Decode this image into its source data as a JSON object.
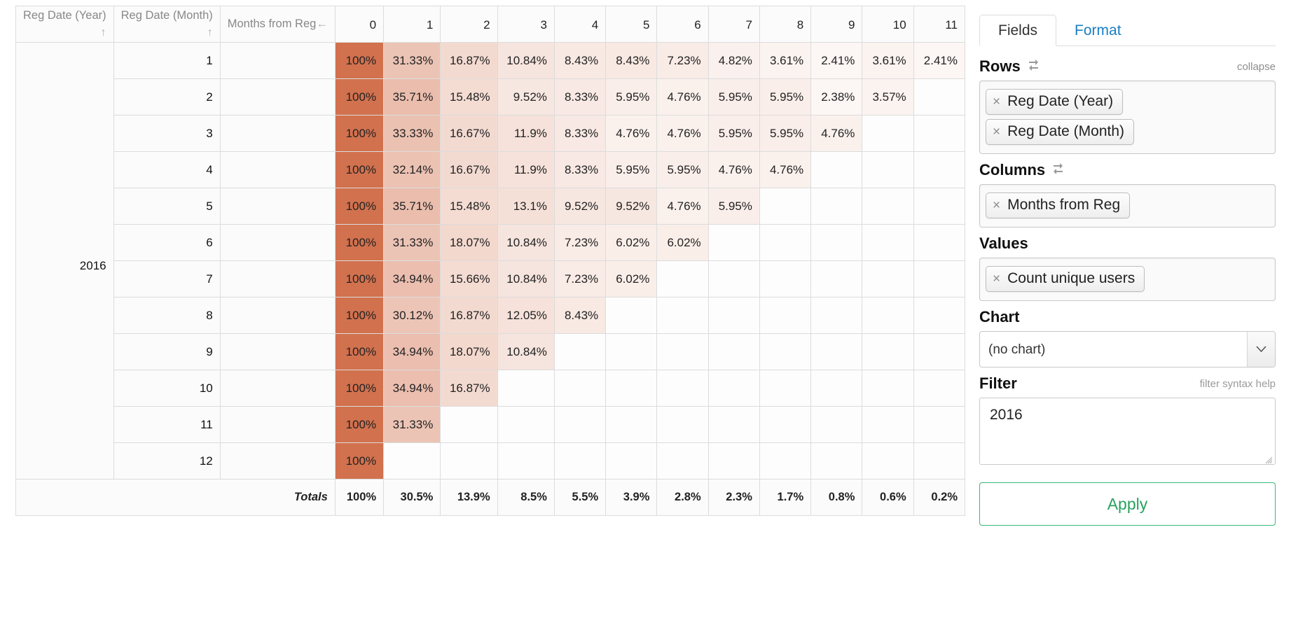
{
  "table": {
    "row_headers": [
      {
        "label": "Reg Date (Year)",
        "sort": "↑"
      },
      {
        "label": "Reg Date (Month)",
        "sort": "↑"
      },
      {
        "label": "Months from Reg",
        "sort": "←"
      }
    ],
    "column_headers": [
      "0",
      "1",
      "2",
      "3",
      "4",
      "5",
      "6",
      "7",
      "8",
      "9",
      "10",
      "11"
    ],
    "year": "2016",
    "rows": [
      {
        "month": "1",
        "values": [
          "100%",
          "31.33%",
          "16.87%",
          "10.84%",
          "8.43%",
          "8.43%",
          "7.23%",
          "4.82%",
          "3.61%",
          "2.41%",
          "3.61%",
          "2.41%"
        ]
      },
      {
        "month": "2",
        "values": [
          "100%",
          "35.71%",
          "15.48%",
          "9.52%",
          "8.33%",
          "5.95%",
          "4.76%",
          "5.95%",
          "5.95%",
          "2.38%",
          "3.57%",
          ""
        ]
      },
      {
        "month": "3",
        "values": [
          "100%",
          "33.33%",
          "16.67%",
          "11.9%",
          "8.33%",
          "4.76%",
          "4.76%",
          "5.95%",
          "5.95%",
          "4.76%",
          "",
          ""
        ]
      },
      {
        "month": "4",
        "values": [
          "100%",
          "32.14%",
          "16.67%",
          "11.9%",
          "8.33%",
          "5.95%",
          "5.95%",
          "4.76%",
          "4.76%",
          "",
          "",
          ""
        ]
      },
      {
        "month": "5",
        "values": [
          "100%",
          "35.71%",
          "15.48%",
          "13.1%",
          "9.52%",
          "9.52%",
          "4.76%",
          "5.95%",
          "",
          "",
          "",
          ""
        ]
      },
      {
        "month": "6",
        "values": [
          "100%",
          "31.33%",
          "18.07%",
          "10.84%",
          "7.23%",
          "6.02%",
          "6.02%",
          "",
          "",
          "",
          "",
          ""
        ]
      },
      {
        "month": "7",
        "values": [
          "100%",
          "34.94%",
          "15.66%",
          "10.84%",
          "7.23%",
          "6.02%",
          "",
          "",
          "",
          "",
          "",
          ""
        ]
      },
      {
        "month": "8",
        "values": [
          "100%",
          "30.12%",
          "16.87%",
          "12.05%",
          "8.43%",
          "",
          "",
          "",
          "",
          "",
          "",
          ""
        ]
      },
      {
        "month": "9",
        "values": [
          "100%",
          "34.94%",
          "18.07%",
          "10.84%",
          "",
          "",
          "",
          "",
          "",
          "",
          "",
          ""
        ]
      },
      {
        "month": "10",
        "values": [
          "100%",
          "34.94%",
          "16.87%",
          "",
          "",
          "",
          "",
          "",
          "",
          "",
          "",
          ""
        ]
      },
      {
        "month": "11",
        "values": [
          "100%",
          "31.33%",
          "",
          "",
          "",
          "",
          "",
          "",
          "",
          "",
          "",
          ""
        ]
      },
      {
        "month": "12",
        "values": [
          "100%",
          "",
          "",
          "",
          "",
          "",
          "",
          "",
          "",
          "",
          "",
          ""
        ]
      }
    ],
    "totals_label": "Totals",
    "totals": [
      "100%",
      "30.5%",
      "13.9%",
      "8.5%",
      "5.5%",
      "3.9%",
      "2.8%",
      "2.3%",
      "1.7%",
      "0.8%",
      "0.6%",
      "0.2%"
    ]
  },
  "panel": {
    "tabs": [
      {
        "label": "Fields",
        "active": true
      },
      {
        "label": "Format",
        "active": false
      }
    ],
    "rows": {
      "title": "Rows",
      "collapse_label": "collapse",
      "pills": [
        "Reg Date (Year)",
        "Reg Date (Month)"
      ]
    },
    "columns": {
      "title": "Columns",
      "pills": [
        "Months from Reg"
      ]
    },
    "values": {
      "title": "Values",
      "pills": [
        "Count unique users"
      ]
    },
    "chart": {
      "title": "Chart",
      "selected": "(no chart)",
      "options": [
        "(no chart)"
      ]
    },
    "filter": {
      "title": "Filter",
      "syntax_help_label": "filter syntax help",
      "value": "2016"
    },
    "apply_label": "Apply",
    "remove_glyph": "×"
  },
  "colors": {
    "heat_max": "#d2714e",
    "heat_min": "#ffffff",
    "tab_link": "#1a7ec2",
    "apply_green": "#27a25f"
  },
  "chart_data": {
    "type": "heatmap",
    "title": "Cohort retention by registration month (2016)",
    "xlabel": "Months from Reg",
    "ylabel": "Reg Date (Month)",
    "x": [
      "0",
      "1",
      "2",
      "3",
      "4",
      "5",
      "6",
      "7",
      "8",
      "9",
      "10",
      "11"
    ],
    "y": [
      "1",
      "2",
      "3",
      "4",
      "5",
      "6",
      "7",
      "8",
      "9",
      "10",
      "11",
      "12"
    ],
    "unit": "percent",
    "values": [
      [
        100,
        31.33,
        16.87,
        10.84,
        8.43,
        8.43,
        7.23,
        4.82,
        3.61,
        2.41,
        3.61,
        2.41
      ],
      [
        100,
        35.71,
        15.48,
        9.52,
        8.33,
        5.95,
        4.76,
        5.95,
        5.95,
        2.38,
        3.57,
        null
      ],
      [
        100,
        33.33,
        16.67,
        11.9,
        8.33,
        4.76,
        4.76,
        5.95,
        5.95,
        4.76,
        null,
        null
      ],
      [
        100,
        32.14,
        16.67,
        11.9,
        8.33,
        5.95,
        5.95,
        4.76,
        4.76,
        null,
        null,
        null
      ],
      [
        100,
        35.71,
        15.48,
        13.1,
        9.52,
        9.52,
        4.76,
        5.95,
        null,
        null,
        null,
        null
      ],
      [
        100,
        31.33,
        18.07,
        10.84,
        7.23,
        6.02,
        6.02,
        null,
        null,
        null,
        null,
        null
      ],
      [
        100,
        34.94,
        15.66,
        10.84,
        7.23,
        6.02,
        null,
        null,
        null,
        null,
        null,
        null
      ],
      [
        100,
        30.12,
        16.87,
        12.05,
        8.43,
        null,
        null,
        null,
        null,
        null,
        null,
        null
      ],
      [
        100,
        34.94,
        18.07,
        10.84,
        null,
        null,
        null,
        null,
        null,
        null,
        null,
        null
      ],
      [
        100,
        34.94,
        16.87,
        null,
        null,
        null,
        null,
        null,
        null,
        null,
        null,
        null
      ],
      [
        100,
        31.33,
        null,
        null,
        null,
        null,
        null,
        null,
        null,
        null,
        null,
        null
      ],
      [
        100,
        null,
        null,
        null,
        null,
        null,
        null,
        null,
        null,
        null,
        null,
        null
      ]
    ],
    "totals": [
      100,
      30.5,
      13.9,
      8.5,
      5.5,
      3.9,
      2.8,
      2.3,
      1.7,
      0.8,
      0.6,
      0.2
    ],
    "colormap": {
      "low": "#ffffff",
      "high": "#d2714e",
      "scale_max": 100
    }
  }
}
